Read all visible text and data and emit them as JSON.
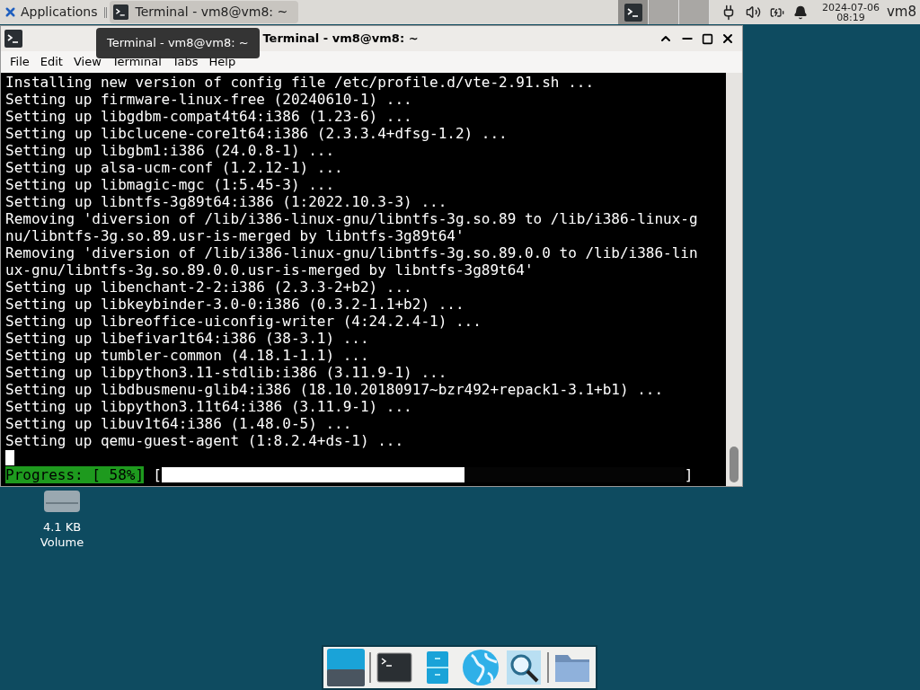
{
  "panel": {
    "applications": "Applications",
    "tasks": [
      {
        "label": "Terminal - vm8@vm8: ~",
        "selected": true
      }
    ],
    "workspaces": [
      {
        "selected": true
      },
      {
        "selected": false
      },
      {
        "selected": false
      }
    ],
    "date": "2024-07-06",
    "time": "08:19",
    "user": "vm8"
  },
  "window": {
    "title": "Terminal - vm8@vm8: ~",
    "menu": [
      "File",
      "Edit",
      "View",
      "Terminal",
      "Tabs",
      "Help"
    ],
    "lines": [
      "Installing new version of config file /etc/profile.d/vte-2.91.sh ...",
      "Setting up firmware-linux-free (20240610-1) ...",
      "Setting up libgdbm-compat4t64:i386 (1.23-6) ...",
      "Setting up libclucene-core1t64:i386 (2.3.3.4+dfsg-1.2) ...",
      "Setting up libgbm1:i386 (24.0.8-1) ...",
      "Setting up alsa-ucm-conf (1.2.12-1) ...",
      "Setting up libmagic-mgc (1:5.45-3) ...",
      "Setting up libntfs-3g89t64:i386 (1:2022.10.3-3) ...",
      "Removing 'diversion of /lib/i386-linux-gnu/libntfs-3g.so.89 to /lib/i386-linux-g",
      "nu/libntfs-3g.so.89.usr-is-merged by libntfs-3g89t64'",
      "Removing 'diversion of /lib/i386-linux-gnu/libntfs-3g.so.89.0.0 to /lib/i386-lin",
      "ux-gnu/libntfs-3g.so.89.0.0.usr-is-merged by libntfs-3g89t64'",
      "Setting up libenchant-2-2:i386 (2.3.3-2+b2) ...",
      "Setting up libkeybinder-3.0-0:i386 (0.3.2-1.1+b2) ...",
      "Setting up libreoffice-uiconfig-writer (4:24.2.4-1) ...",
      "Setting up libefivar1t64:i386 (38-3.1) ...",
      "Setting up tumbler-common (4.18.1-1.1) ...",
      "Setting up libpython3.11-stdlib:i386 (3.11.9-1) ...",
      "Setting up libdbusmenu-glib4:i386 (18.10.20180917~bzr492+repack1-3.1+b1) ...",
      "Setting up libpython3.11t64:i386 (3.11.9-1) ...",
      "Setting up libuv1t64:i386 (1.48.0-5) ...",
      "Setting up qemu-guest-agent (1:8.2.4+ds-1) ..."
    ],
    "progress": {
      "label": "Progress: [ 58%]",
      "open": "[",
      "close": "]",
      "level": 0.58
    },
    "tooltip": "Terminal - vm8@vm8: ~"
  },
  "desktop_icons": [
    {
      "label": "4.1 KB",
      "sublabel": "Volume"
    }
  ],
  "dock": [
    {
      "kind": "desktop"
    },
    {
      "kind": "terminal"
    },
    {
      "kind": "files"
    },
    {
      "kind": "browser"
    },
    {
      "kind": "search"
    },
    {
      "kind": "folder"
    }
  ]
}
